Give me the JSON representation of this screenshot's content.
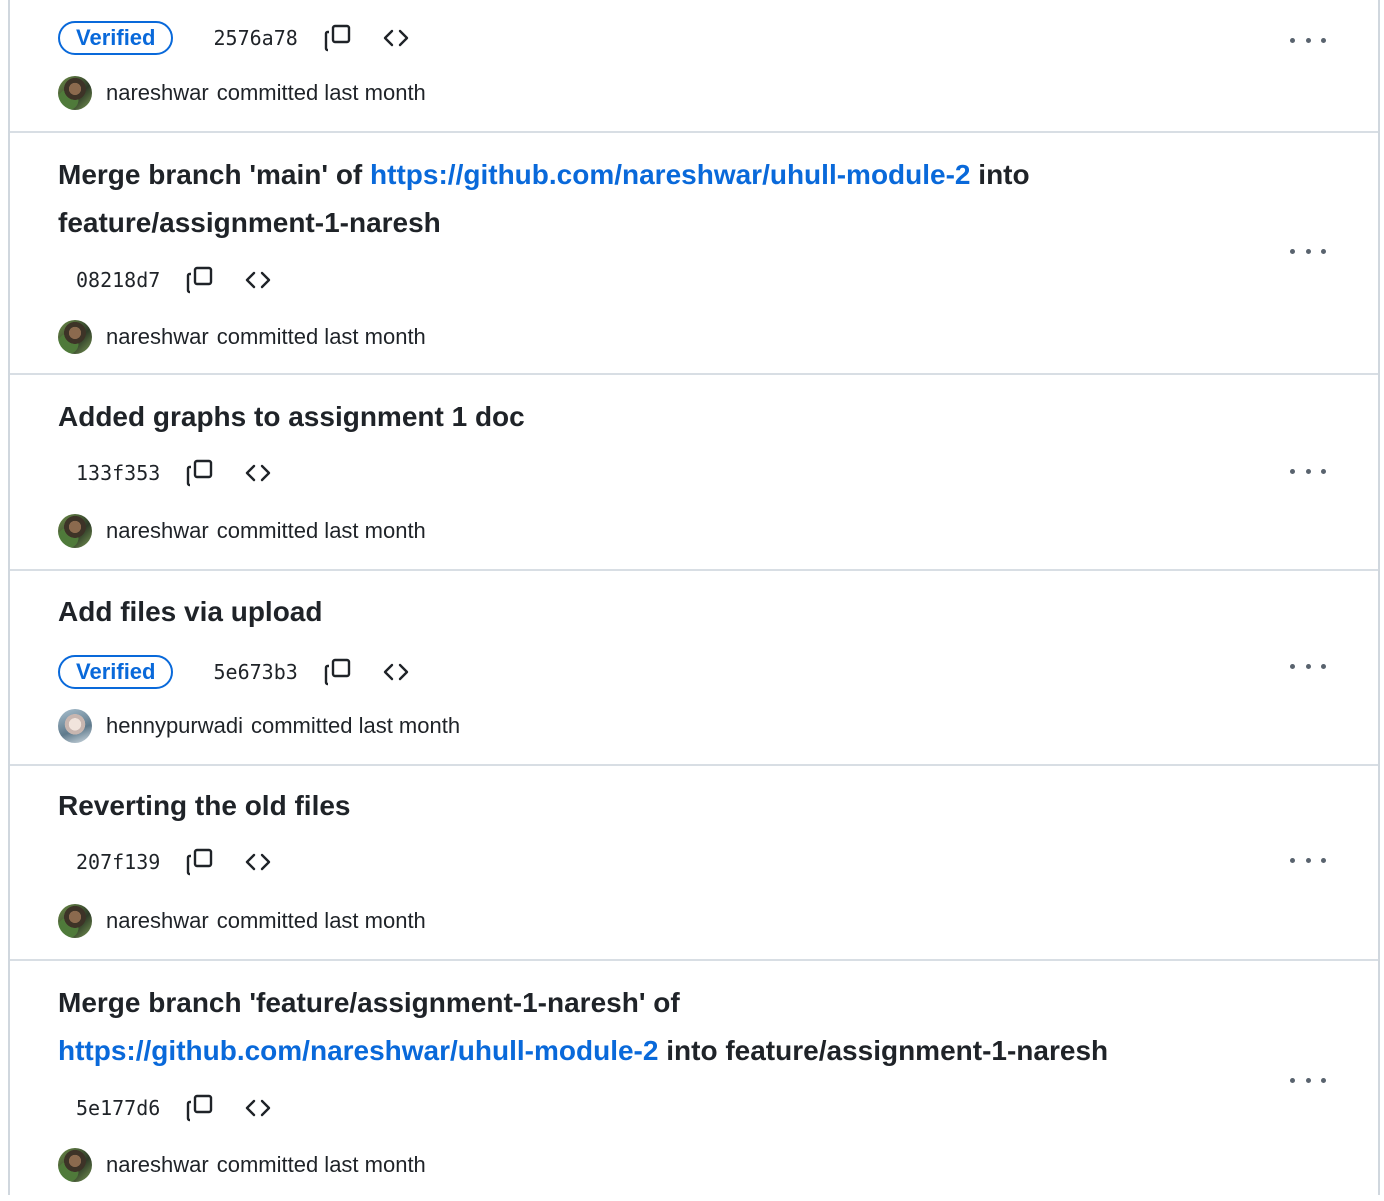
{
  "commits": [
    {
      "title_text": "",
      "title_link": "",
      "title_suffix": "",
      "title_line2": "",
      "verified": true,
      "sha": "2576a78",
      "author": "nareshwar",
      "time": "committed last month",
      "avatar": "nareshwar-avatar"
    },
    {
      "title_text": "Merge branch 'main' of ",
      "title_link": "https://github.com/nareshwar/uhull-module-2",
      "title_suffix": " into",
      "title_line2": "feature/assignment-1-naresh",
      "verified": false,
      "sha": "08218d7",
      "author": "nareshwar",
      "time": "committed last month",
      "avatar": "nareshwar-avatar"
    },
    {
      "title_text": "Added graphs to assignment 1 doc",
      "verified": false,
      "sha": "133f353",
      "author": "nareshwar",
      "time": "committed last month",
      "avatar": "nareshwar-avatar"
    },
    {
      "title_text": "Add files via upload",
      "verified": true,
      "sha": "5e673b3",
      "author": "hennypurwadi",
      "time": "committed last month",
      "avatar": "hennypurwadi-avatar"
    },
    {
      "title_text": "Reverting the old files",
      "verified": false,
      "sha": "207f139",
      "author": "nareshwar",
      "time": "committed last month",
      "avatar": "nareshwar-avatar"
    },
    {
      "title_text": "Merge branch 'feature/assignment-1-naresh' of",
      "title_link": "https://github.com/nareshwar/uhull-module-2",
      "title_suffix": " into feature/assignment-1-naresh",
      "verified": false,
      "sha": "5e177d6",
      "author": "nareshwar",
      "time": "committed last month",
      "avatar": "nareshwar-avatar"
    }
  ],
  "labels": {
    "verified": "Verified"
  },
  "icons": {
    "copy": "copy-icon",
    "browse": "code-icon",
    "more": "kebab-horizontal-icon"
  },
  "colors": {
    "link": "#0969da",
    "border": "#d0d7de",
    "text": "#1f2328",
    "muted": "#59636e"
  }
}
